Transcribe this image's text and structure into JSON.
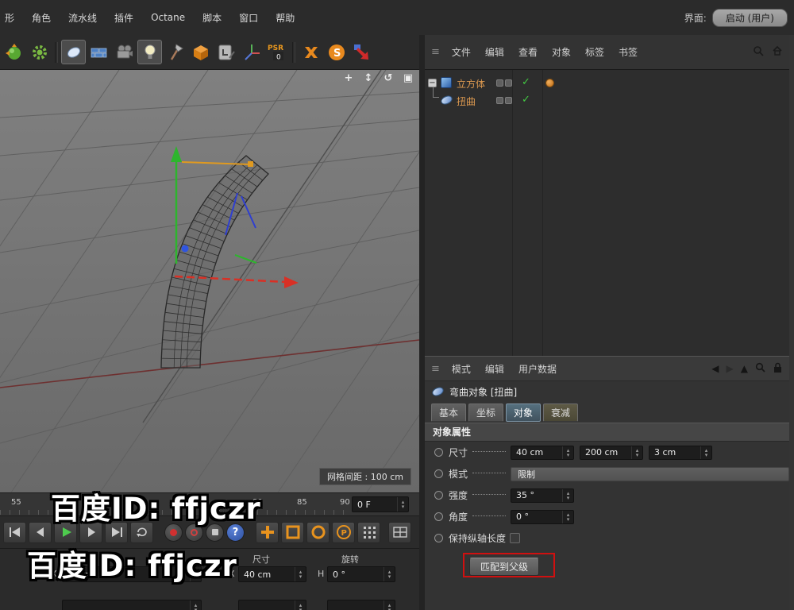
{
  "menubar": {
    "items": [
      "形",
      "角色",
      "流水线",
      "插件",
      "Octane",
      "脚本",
      "窗口",
      "帮助"
    ],
    "interface_label": "界面:",
    "interface_value": "启动 (用户)"
  },
  "toolbar": {
    "icons": [
      "selection-ball",
      "gear",
      "bend-deformer",
      "floor-tiles",
      "camera",
      "light",
      "axe",
      "cube",
      "tablet-pen",
      "axis-xyz",
      "psr-zero",
      "xpresso",
      "sketch-s",
      "render-arrow"
    ],
    "psr_text": "PSR",
    "psr_value": "0"
  },
  "viewport": {
    "nav_icons": [
      "pan",
      "dolly",
      "orbit",
      "maximize"
    ],
    "grid_label": "网格间距 : 100 cm"
  },
  "object_manager": {
    "menus": [
      "文件",
      "编辑",
      "查看",
      "对象",
      "标签",
      "书签"
    ],
    "header_icons": [
      "search",
      "home"
    ],
    "items": [
      {
        "name": "立方体",
        "icon": "cube",
        "tags": [
          "visibility-dots",
          "enabled-check",
          "phong-tag"
        ]
      },
      {
        "name": "扭曲",
        "icon": "bend",
        "tags": [
          "visibility-dots",
          "enabled-check"
        ]
      }
    ]
  },
  "attributes": {
    "menus": [
      "模式",
      "编辑",
      "用户数据"
    ],
    "header_icons": [
      "back",
      "forward",
      "up",
      "search",
      "lock"
    ],
    "title": "弯曲对象 [扭曲]",
    "tabs": [
      "基本",
      "坐标",
      "对象",
      "衰减"
    ],
    "active_tab": "对象",
    "section": "对象属性",
    "params": {
      "size": {
        "label": "尺寸",
        "values": [
          "40 cm",
          "200 cm",
          "3 cm"
        ]
      },
      "mode": {
        "label": "模式",
        "value": "限制"
      },
      "strength": {
        "label": "强度",
        "value": "35 °"
      },
      "angle": {
        "label": "角度",
        "value": "0 °"
      },
      "keep_length": {
        "label": "保持纵轴长度",
        "checked": false
      },
      "fit_to_parent": {
        "label": "匹配到父级"
      }
    }
  },
  "timeline": {
    "ticks": [
      "55",
      "80",
      "85",
      "90"
    ],
    "frame": "0 F"
  },
  "transport": {
    "icons": [
      "go-start",
      "prev-frame",
      "play",
      "next-frame",
      "go-end",
      "loop",
      "record-keyframe",
      "autokey",
      "keyframe-selection",
      "help",
      "key-position",
      "key-scale",
      "key-rotation",
      "key-parameter",
      "key-pla",
      "snap-table"
    ]
  },
  "coords": {
    "headers": [
      "尺寸",
      "旋转"
    ],
    "fields": [
      {
        "axis": "X",
        "value": "0 cm"
      },
      {
        "axis": "X",
        "value": "40 cm"
      },
      {
        "axis": "H",
        "value": "0 °"
      }
    ]
  },
  "watermark": {
    "line1": "百度ID: ffjczr",
    "line2": "百度ID: ffjczr"
  },
  "colors": {
    "axis_x": "#d93025",
    "axis_y": "#2db52d",
    "axis_z": "#2f3fd0",
    "accent_orange": "#e8931e",
    "check_green": "#43c943",
    "selected_text": "#de9a50",
    "annotation_red": "#d01010"
  }
}
